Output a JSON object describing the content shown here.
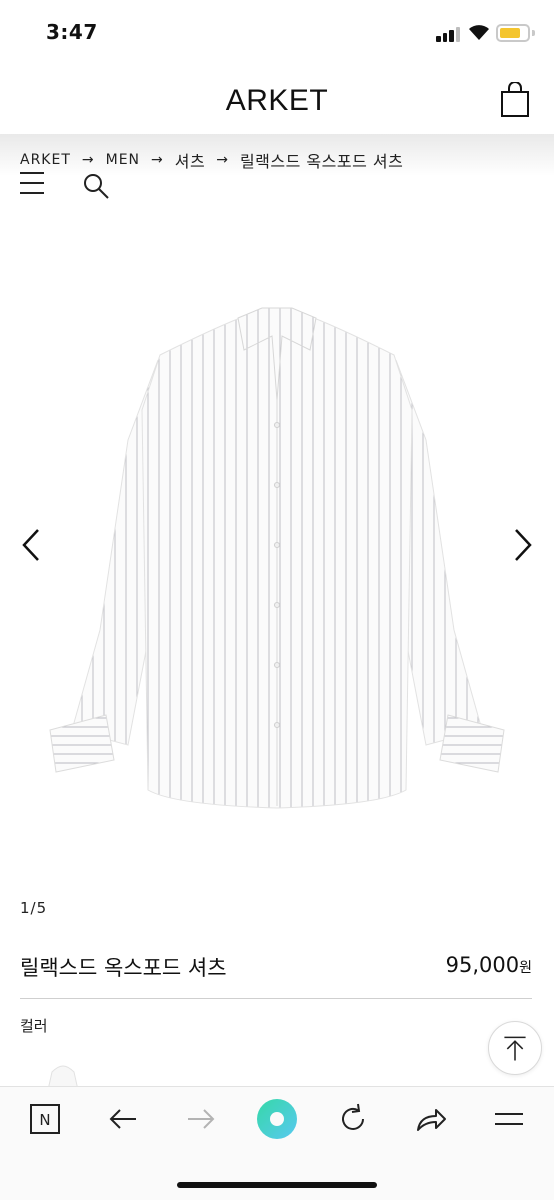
{
  "status_bar": {
    "time": "3:47",
    "battery_color": "#f4c52e"
  },
  "header": {
    "brand": "ARKET",
    "cart_icon": "shopping-bag-icon"
  },
  "breadcrumb": {
    "items": [
      "ARKET",
      "MEN",
      "셔츠",
      "릴랙스드 옥스포드 셔츠"
    ],
    "separator": "→"
  },
  "nav_icons": [
    "menu-icon",
    "search-icon"
  ],
  "gallery": {
    "current": "1/5",
    "prev_icon": "chevron-left-icon",
    "next_icon": "chevron-right-icon"
  },
  "product": {
    "name": "릴랙스드 옥스포드 셔츠",
    "price": "95,000",
    "currency": "원",
    "color_label": "컬러"
  },
  "scroll_top_icon": "arrow-up-to-top-icon",
  "toolbar": {
    "icons": [
      "naver-n-icon",
      "back-arrow-icon",
      "forward-arrow-icon",
      "green-dot-icon",
      "reload-icon",
      "share-icon",
      "hamburger-menu-icon"
    ],
    "accent_color": "#3ad6a0"
  }
}
